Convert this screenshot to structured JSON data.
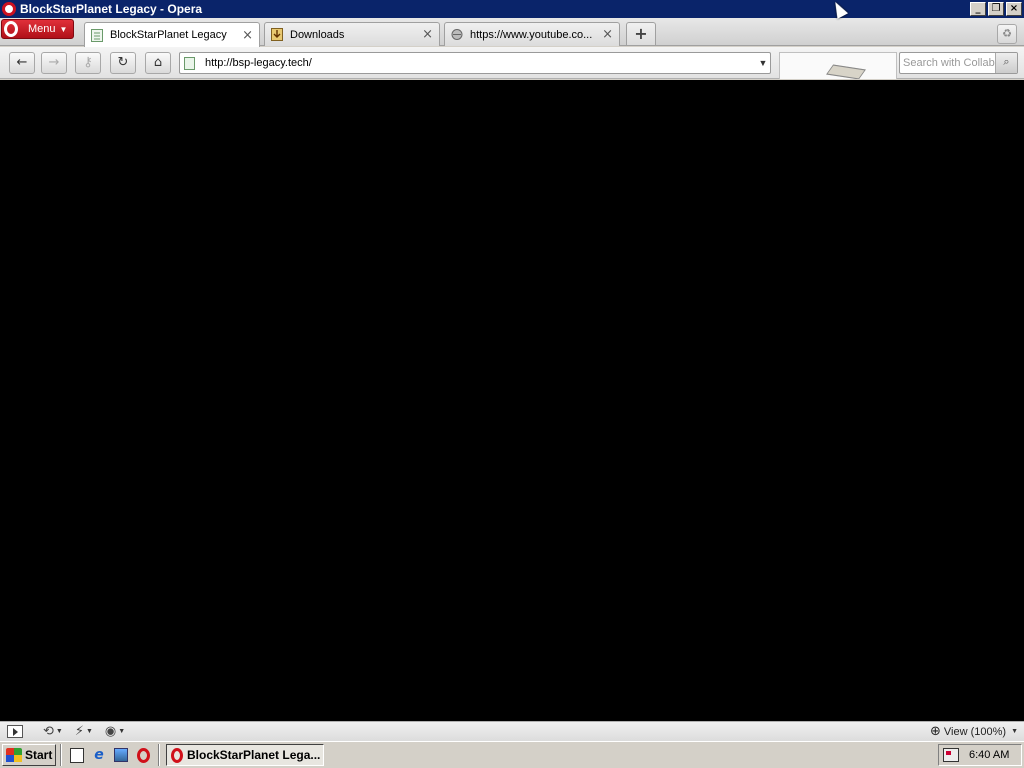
{
  "window": {
    "title": "BlockStarPlanet Legacy - Opera",
    "minimize_glyph": "_",
    "restore_glyph": "❐",
    "close_glyph": "×"
  },
  "menu": {
    "label": "Menu"
  },
  "tabs": [
    {
      "label": "BlockStarPlanet Legacy",
      "active": true,
      "icon": "page-icon"
    },
    {
      "label": "Downloads",
      "active": false,
      "icon": "download-icon"
    },
    {
      "label": "https://www.youtube.co...",
      "active": false,
      "icon": "globe-icon"
    }
  ],
  "tab_close_glyph": "×",
  "new_tab_glyph": "+",
  "toolbar": {
    "back_glyph": "←",
    "forward_glyph": "→",
    "key_glyph": "⚷",
    "reload_glyph": "↻",
    "home_glyph": "⌂",
    "url": "http://bsp-legacy.tech/",
    "search_placeholder": "Search with Collab"
  },
  "content": {
    "background": "#000000"
  },
  "statusbar": {
    "zoom_label": "View (100%)"
  },
  "taskbar": {
    "start_label": "Start",
    "task_label": "BlockStarPlanet Lega...",
    "clock": "6:40 AM"
  },
  "colors": {
    "titlebar": "#0a246a",
    "opera_red": "#cc1020",
    "content_bg": "#000000"
  }
}
